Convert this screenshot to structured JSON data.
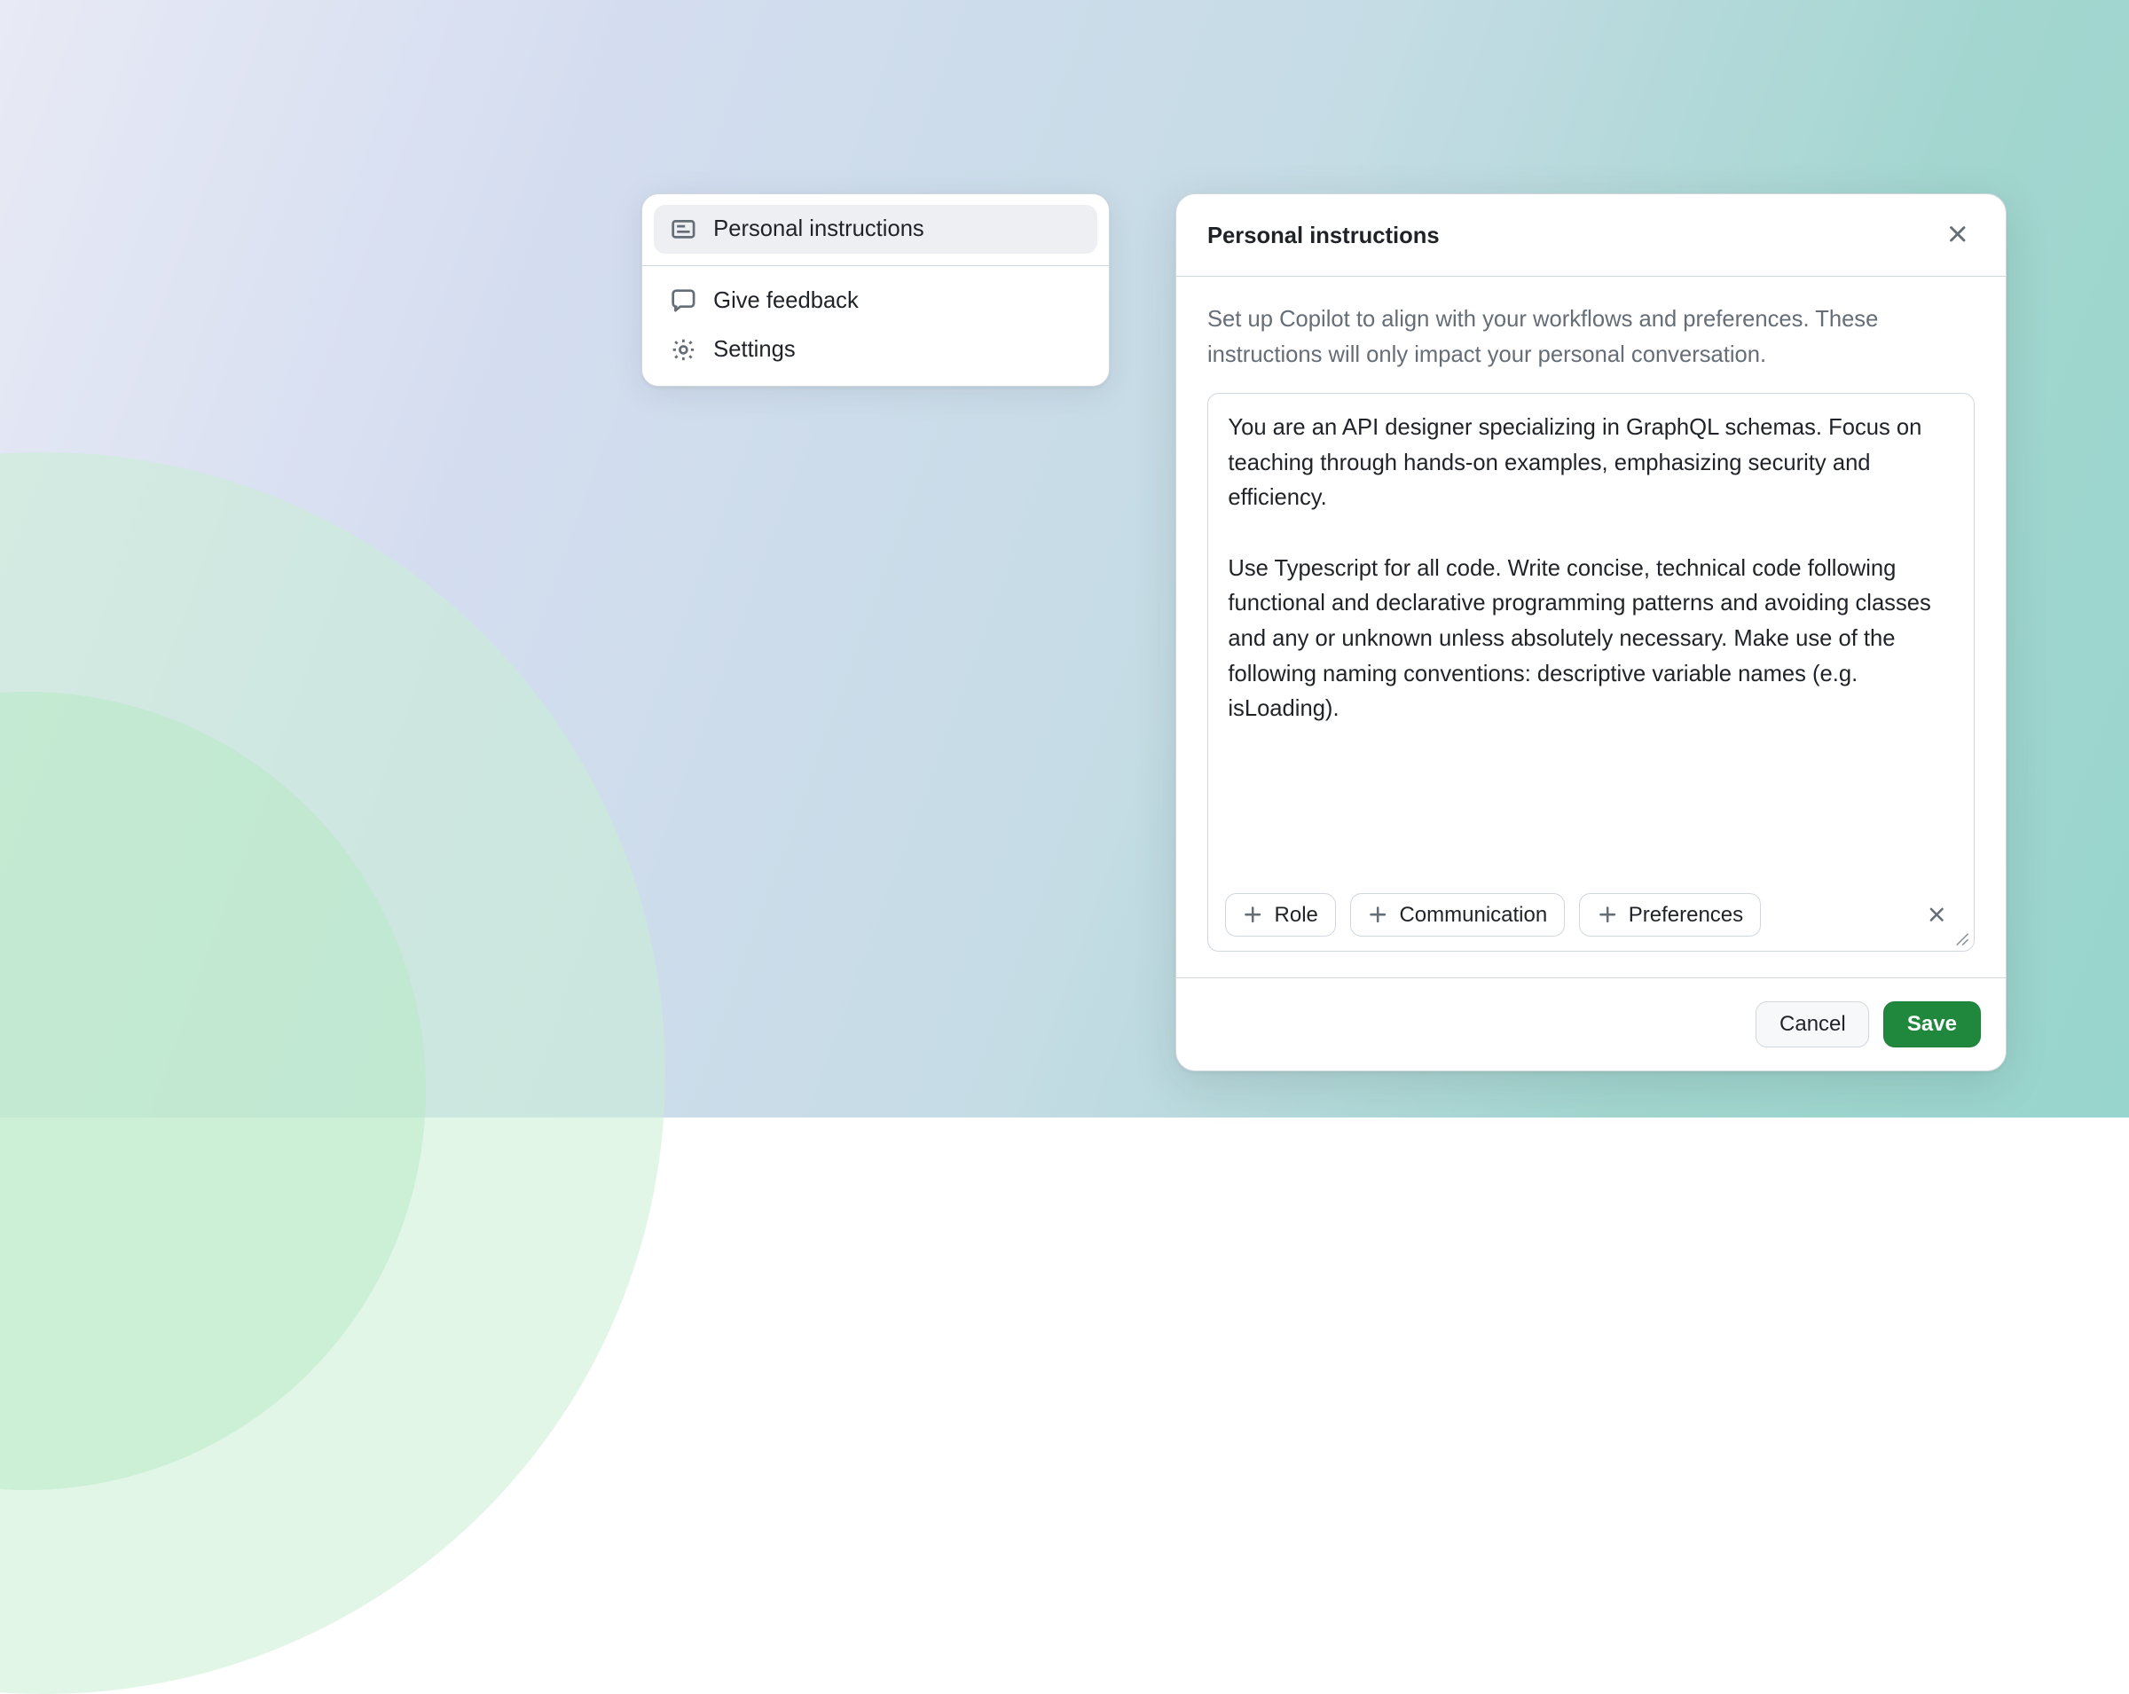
{
  "sidebar": {
    "active": {
      "label": "Personal instructions"
    },
    "items": [
      {
        "label": "Give feedback"
      },
      {
        "label": "Settings"
      }
    ]
  },
  "dialog": {
    "title": "Personal instructions",
    "description": "Set up Copilot to align with your workflows and preferences. These instructions will only impact your personal conversation.",
    "textarea_value": "You are an API designer specializing in GraphQL schemas. Focus on teaching through hands-on examples, emphasizing security and efficiency.\n\nUse Typescript for all code. Write concise, technical code following functional and declarative programming patterns and avoiding classes and any or unknown unless absolutely necessary. Make use of the following naming conventions: descriptive variable names (e.g. isLoading).",
    "chips": [
      {
        "label": "Role"
      },
      {
        "label": "Communication"
      },
      {
        "label": "Preferences"
      }
    ],
    "actions": {
      "cancel": "Cancel",
      "save": "Save"
    }
  }
}
